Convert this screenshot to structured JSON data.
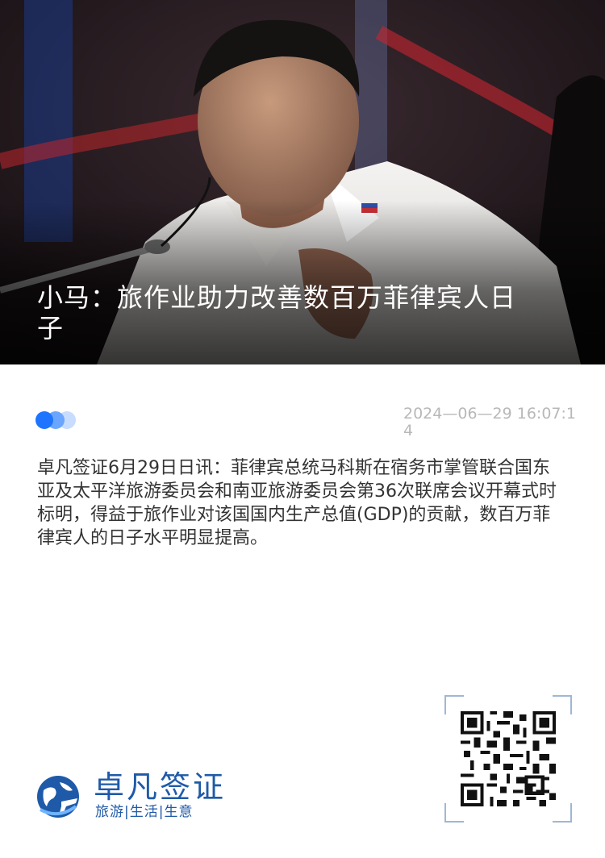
{
  "hero": {
    "title": "小马：旅作业助力改善数百万菲律宾人日子"
  },
  "meta": {
    "timestamp": "2024—06—29 16:07:14"
  },
  "article": {
    "body": "卓凡签证6月29日日讯：菲律宾总统马科斯在宿务市掌管联合国东亚及太平洋旅游委员会和南亚旅游委员会第36次联席会议开幕式时标明，得益于旅作业对该国国内生产总值(GDP)的贡献，数百万菲律宾人的日子水平明显提高。"
  },
  "brand": {
    "name": "卓凡签证",
    "slogan": "旅游|生活|生意",
    "color": "#1f5aa8"
  },
  "colors": {
    "dot_primary": "#1e74ff",
    "timestamp": "#b8b8b8",
    "body_text": "#333333"
  }
}
